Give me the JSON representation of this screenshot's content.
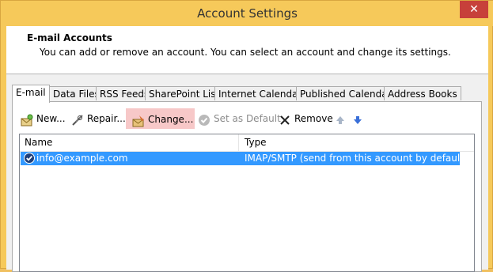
{
  "window": {
    "title": "Account Settings",
    "close_glyph": "✕"
  },
  "header": {
    "title": "E-mail Accounts",
    "description": "You can add or remove an account. You can select an account and change its settings."
  },
  "tabs": [
    {
      "label": "E-mail"
    },
    {
      "label": "Data Files"
    },
    {
      "label": "RSS Feeds"
    },
    {
      "label": "SharePoint Lists"
    },
    {
      "label": "Internet Calendars"
    },
    {
      "label": "Published Calendars"
    },
    {
      "label": "Address Books"
    }
  ],
  "toolbar": {
    "new_label": "New...",
    "repair_label": "Repair...",
    "change_label": "Change...",
    "set_default_label": "Set as Default",
    "remove_label": "Remove"
  },
  "accounts_table": {
    "columns": [
      "Name",
      "Type"
    ],
    "rows": [
      {
        "name": "info@example.com",
        "type": "IMAP/SMTP (send from this account by default)"
      }
    ]
  },
  "colors": {
    "selection": "#3399ff",
    "hover": "#f7c8c8",
    "titlebar": "#f6c95a",
    "close": "#c7403a"
  }
}
